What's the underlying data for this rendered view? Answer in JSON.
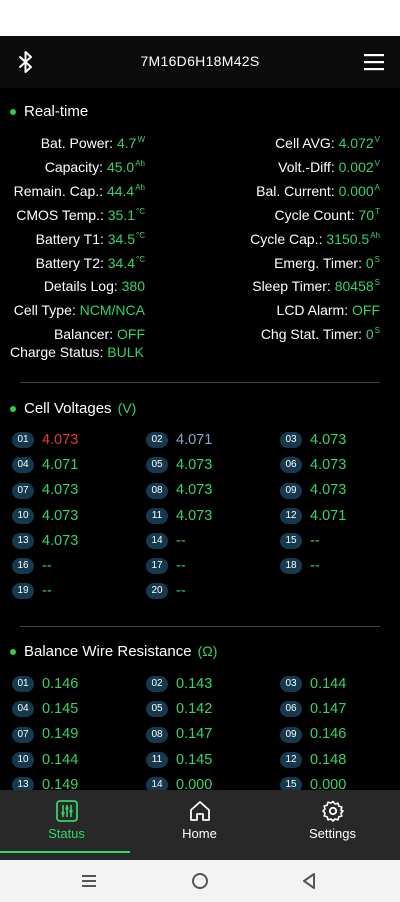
{
  "app": {
    "title": "7M16D6H18M42S"
  },
  "realtime": {
    "heading": "Real-time",
    "left": [
      {
        "label": "Bat. Power:",
        "value": "4.7",
        "unit": "W"
      },
      {
        "label": "Capacity:",
        "value": "45.0",
        "unit": "Ah"
      },
      {
        "label": "Remain. Cap.:",
        "value": "44.4",
        "unit": "Ah"
      },
      {
        "label": "CMOS Temp.:",
        "value": "35.1",
        "unit": "°C"
      },
      {
        "label": "Battery T1:",
        "value": "34.5",
        "unit": "°C"
      },
      {
        "label": "Battery T2:",
        "value": "34.4",
        "unit": "°C"
      },
      {
        "label": "Details Log:",
        "value": "380",
        "unit": ""
      },
      {
        "label": "Cell Type:",
        "value": "NCM/NCA",
        "unit": ""
      },
      {
        "label": "Balancer:",
        "value": "OFF",
        "unit": ""
      }
    ],
    "right": [
      {
        "label": "Cell AVG:",
        "value": "4.072",
        "unit": "V"
      },
      {
        "label": "Volt.-Diff:",
        "value": "0.002",
        "unit": "V"
      },
      {
        "label": "Bal. Current:",
        "value": "0.000",
        "unit": "A"
      },
      {
        "label": "Cycle Count:",
        "value": "70",
        "unit": "T"
      },
      {
        "label": "Cycle Cap.:",
        "value": "3150.5",
        "unit": "Ah"
      },
      {
        "label": "Emerg. Timer:",
        "value": "0",
        "unit": "S"
      },
      {
        "label": "Sleep Timer:",
        "value": "80458",
        "unit": "S"
      },
      {
        "label": "LCD Alarm:",
        "value": "OFF",
        "unit": ""
      },
      {
        "label": "Chg Stat. Timer:",
        "value": "0",
        "unit": "S"
      }
    ],
    "charge_status": {
      "label": "Charge Status:",
      "value": "BULK"
    }
  },
  "cell_voltages": {
    "heading": "Cell Voltages",
    "unit": "(V)",
    "cells": [
      {
        "n": "01",
        "v": "4.073",
        "state": "max"
      },
      {
        "n": "02",
        "v": "4.071",
        "state": "min"
      },
      {
        "n": "03",
        "v": "4.073",
        "state": ""
      },
      {
        "n": "04",
        "v": "4.071",
        "state": ""
      },
      {
        "n": "05",
        "v": "4.073",
        "state": ""
      },
      {
        "n": "06",
        "v": "4.073",
        "state": ""
      },
      {
        "n": "07",
        "v": "4.073",
        "state": ""
      },
      {
        "n": "08",
        "v": "4.073",
        "state": ""
      },
      {
        "n": "09",
        "v": "4.073",
        "state": ""
      },
      {
        "n": "10",
        "v": "4.073",
        "state": ""
      },
      {
        "n": "11",
        "v": "4.073",
        "state": ""
      },
      {
        "n": "12",
        "v": "4.071",
        "state": ""
      },
      {
        "n": "13",
        "v": "4.073",
        "state": ""
      },
      {
        "n": "14",
        "v": "--",
        "state": ""
      },
      {
        "n": "15",
        "v": "--",
        "state": ""
      },
      {
        "n": "16",
        "v": "--",
        "state": ""
      },
      {
        "n": "17",
        "v": "--",
        "state": ""
      },
      {
        "n": "18",
        "v": "--",
        "state": ""
      },
      {
        "n": "19",
        "v": "--",
        "state": ""
      },
      {
        "n": "20",
        "v": "--",
        "state": ""
      }
    ]
  },
  "wire_resistance": {
    "heading": "Balance Wire Resistance",
    "unit": "(Ω)",
    "cells": [
      {
        "n": "01",
        "v": "0.146"
      },
      {
        "n": "02",
        "v": "0.143"
      },
      {
        "n": "03",
        "v": "0.144"
      },
      {
        "n": "04",
        "v": "0.145"
      },
      {
        "n": "05",
        "v": "0.142"
      },
      {
        "n": "06",
        "v": "0.147"
      },
      {
        "n": "07",
        "v": "0.149"
      },
      {
        "n": "08",
        "v": "0.147"
      },
      {
        "n": "09",
        "v": "0.146"
      },
      {
        "n": "10",
        "v": "0.144"
      },
      {
        "n": "11",
        "v": "0.145"
      },
      {
        "n": "12",
        "v": "0.148"
      },
      {
        "n": "13",
        "v": "0.149"
      },
      {
        "n": "14",
        "v": "0.000"
      },
      {
        "n": "15",
        "v": "0.000"
      }
    ]
  },
  "bottom_nav": {
    "items": [
      {
        "label": "Status",
        "icon": "equalizer-icon",
        "active": true
      },
      {
        "label": "Home",
        "icon": "home-icon",
        "active": false
      },
      {
        "label": "Settings",
        "icon": "gear-icon",
        "active": false
      }
    ]
  },
  "colors": {
    "accent": "#35d46a",
    "max_cell": "#e03a3a",
    "min_cell": "#8aa8c8",
    "badge": "#153a4f"
  }
}
